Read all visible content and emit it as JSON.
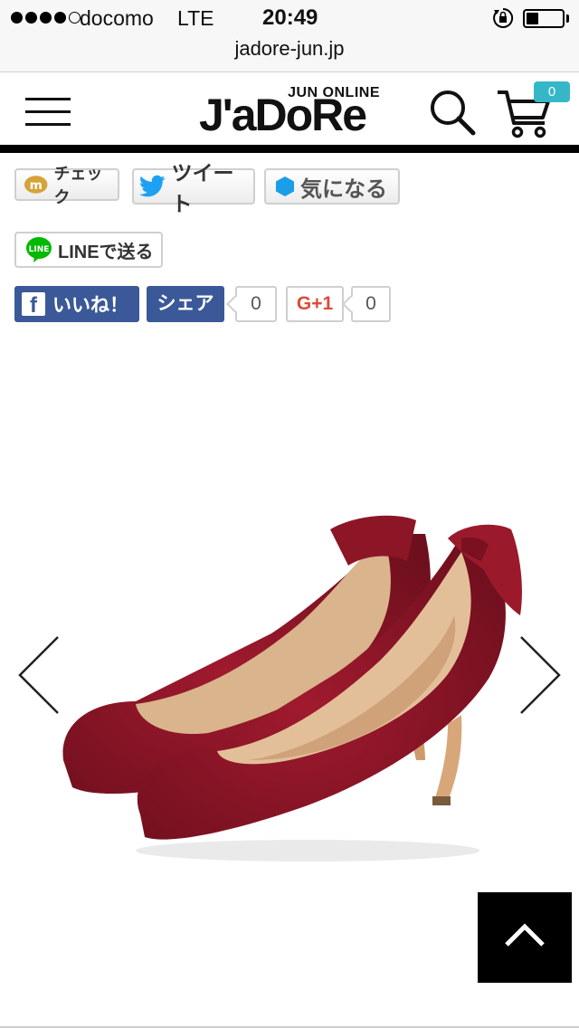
{
  "status_bar": {
    "carrier": "docomo",
    "network": "LTE",
    "time": "20:49",
    "signal_bars_filled": 4,
    "signal_bars_total": 5,
    "battery_level": 0.35
  },
  "browser": {
    "url": "jadore-jun.jp"
  },
  "header": {
    "logo_main": "J'aDoRe",
    "logo_sub": "JUN ONLINE",
    "cart_count": "0",
    "icons": [
      "menu-icon",
      "search-icon",
      "cart-icon"
    ],
    "accent_color": "#36b7c8"
  },
  "share": {
    "mixi_check_label": "チェック",
    "tweet_label": "ツイート",
    "kininaru_label": "気になる",
    "line_label": "LINEで送る",
    "line_badge": "LINE",
    "facebook_like_label": "いいね！",
    "facebook_share_label": "シェア",
    "facebook_count": "0",
    "gplus_label": "G+1",
    "gplus_count": "0",
    "facebook_color": "#3b5998",
    "line_color": "#00b900",
    "twitter_color": "#1da1f2"
  },
  "product": {
    "image_description_icon": "red-pump-shoe-image",
    "prev_icon": "chevron-left-icon",
    "next_icon": "chevron-right-icon"
  },
  "page": {
    "back_to_top_icon": "chevron-up-icon"
  }
}
